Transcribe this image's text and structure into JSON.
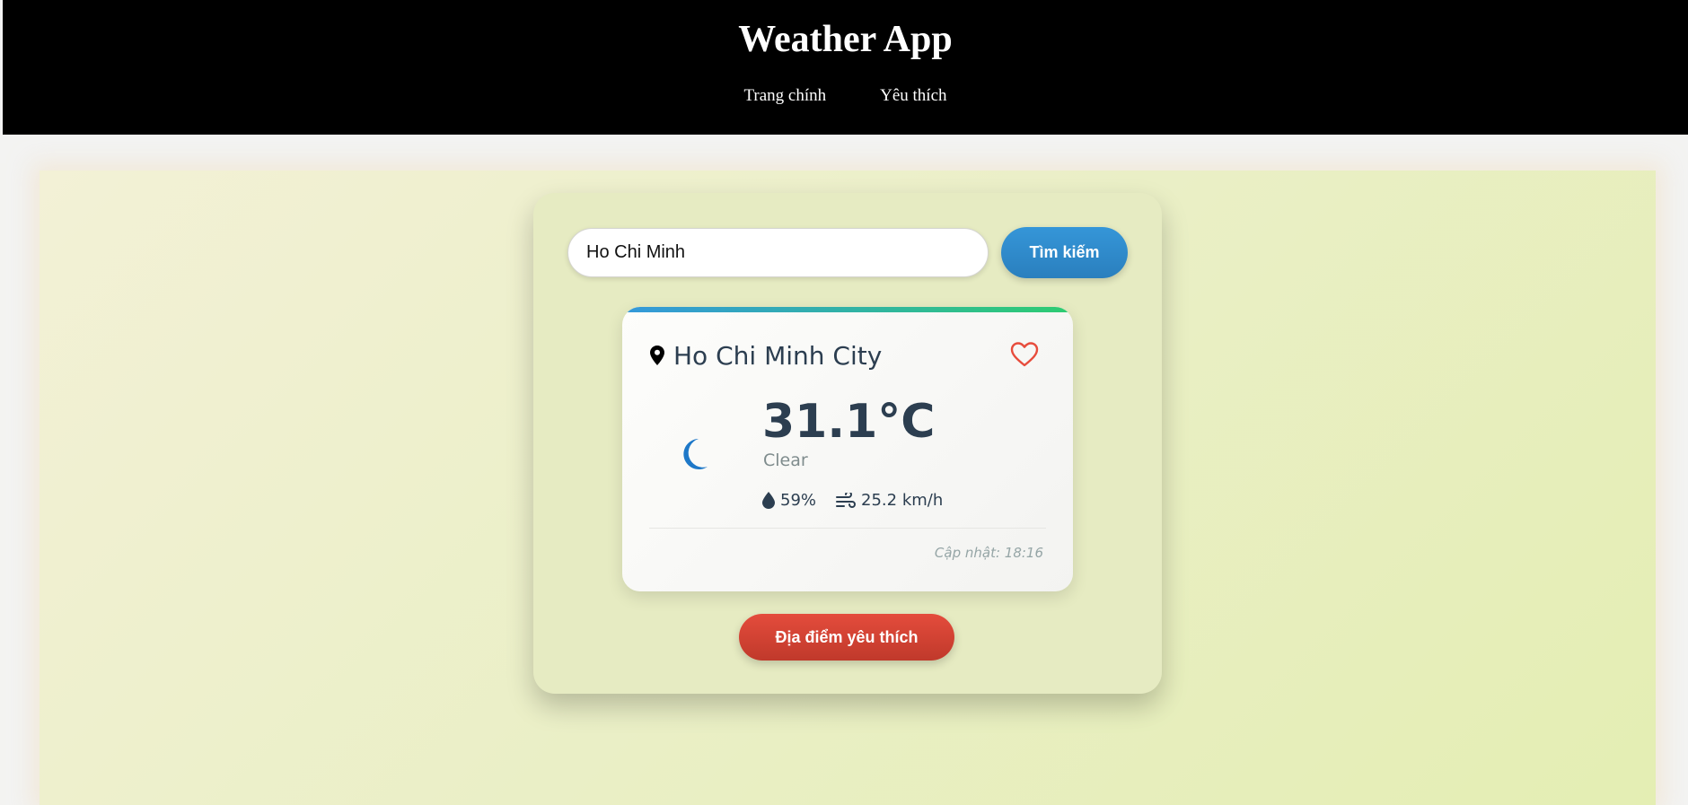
{
  "header": {
    "title": "Weather App",
    "nav": [
      {
        "label": "Trang chính"
      },
      {
        "label": "Yêu thích"
      }
    ]
  },
  "search": {
    "value": "Ho Chi Minh",
    "button_label": "Tìm kiếm"
  },
  "weather_card": {
    "city": "Ho Chi Minh City",
    "temperature": "31.1°C",
    "description": "Clear",
    "humidity": "59%",
    "wind": "25.2 km/h",
    "updated": "Cập nhật: 18:16",
    "icons": {
      "location": "map-pin-icon",
      "favorite": "heart-outline-icon",
      "condition": "moon-icon",
      "humidity": "droplet-icon",
      "wind": "wind-icon"
    },
    "accent_gradient": [
      "#3498db",
      "#2ecc71"
    ]
  },
  "favorites_button": {
    "label": "Địa điểm yêu thích"
  },
  "colors": {
    "header_bg": "#000000",
    "search_button": "#3596d8",
    "favorites_button": "#e44c3c",
    "heart": "#e74c3c",
    "moon": "#1e78c8",
    "text_dark": "#2c3e50"
  }
}
